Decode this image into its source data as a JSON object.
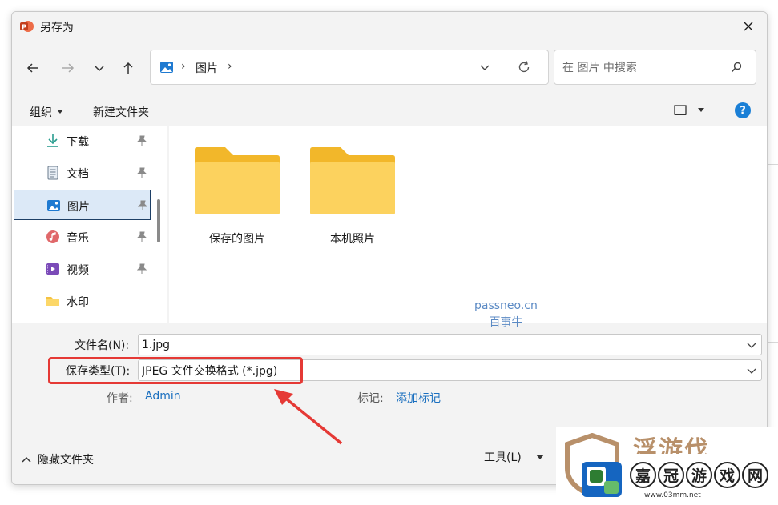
{
  "window": {
    "title": "另存为",
    "close_label": "✕"
  },
  "nav": {
    "back_label": "←",
    "forward_label": "→",
    "recent_label": "⌄",
    "up_label": "↑"
  },
  "address": {
    "separator": "›",
    "current": "图片"
  },
  "search": {
    "placeholder": "在 图片 中搜索"
  },
  "toolbar": {
    "organize_label": "组织",
    "new_folder_label": "新建文件夹",
    "help_label": "?"
  },
  "sidebar": {
    "items": [
      {
        "label": "下载",
        "icon": "download-icon",
        "pinned": true
      },
      {
        "label": "文档",
        "icon": "document-icon",
        "pinned": true
      },
      {
        "label": "图片",
        "icon": "pictures-icon",
        "pinned": true,
        "selected": true
      },
      {
        "label": "音乐",
        "icon": "music-icon",
        "pinned": true
      },
      {
        "label": "视频",
        "icon": "video-icon",
        "pinned": true
      },
      {
        "label": "水印",
        "icon": "folder-icon",
        "pinned": false
      }
    ]
  },
  "folders": [
    {
      "name": "保存的图片"
    },
    {
      "name": "本机照片"
    }
  ],
  "watermark": {
    "line1": "passneo.cn",
    "line2": "百事牛"
  },
  "form": {
    "filename_label": "文件名(N):",
    "filename_value": "1.jpg",
    "filetype_label": "保存类型(T):",
    "filetype_value": "JPEG 文件交换格式 (*.jpg)",
    "author_label": "作者:",
    "author_value": "Admin",
    "tags_label": "标记:",
    "tags_value": "添加标记"
  },
  "footer": {
    "hide_folders_label": "隐藏文件夹",
    "tools_label": "工具(L)"
  },
  "logo": {
    "top_text": "浮游伐",
    "chars": [
      "嘉",
      "冠",
      "游",
      "戏",
      "网"
    ],
    "url": "www.03mm.net"
  },
  "colors": {
    "accent": "#1a7fd6",
    "highlight": "#e53935",
    "link": "#1a6fbf",
    "folder": "#f5c242"
  }
}
